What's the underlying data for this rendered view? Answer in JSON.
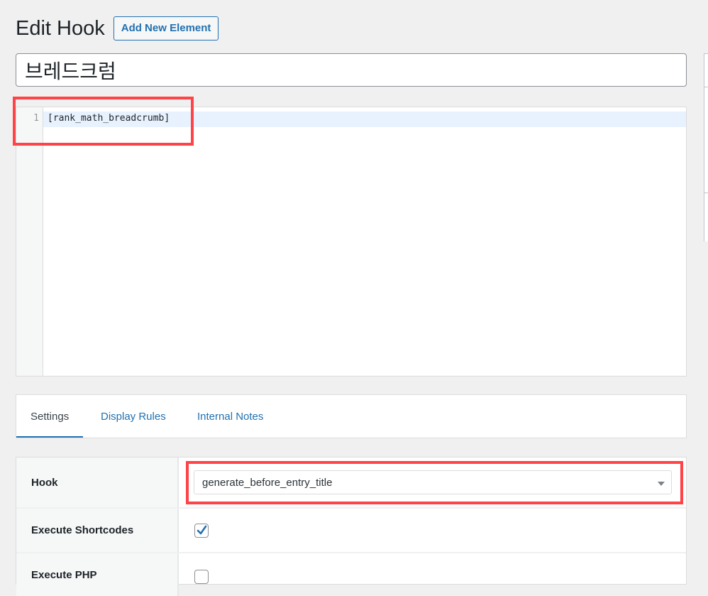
{
  "header": {
    "title": "Edit Hook",
    "add_new_label": "Add New Element"
  },
  "post_title": "브레드크럼",
  "editor": {
    "line_numbers": [
      "1"
    ],
    "lines": [
      "[rank_math_breadcrumb]"
    ]
  },
  "tabs": [
    {
      "label": "Settings",
      "active": true
    },
    {
      "label": "Display Rules",
      "active": false
    },
    {
      "label": "Internal Notes",
      "active": false
    }
  ],
  "settings": {
    "hook_label": "Hook",
    "hook_value": "generate_before_entry_title",
    "execute_shortcodes_label": "Execute Shortcodes",
    "execute_shortcodes_checked": true,
    "execute_php_label": "Execute PHP",
    "execute_php_checked": false
  },
  "colors": {
    "accent": "#2271b1",
    "highlight": "#ff4347",
    "background": "#f0f0f1"
  }
}
